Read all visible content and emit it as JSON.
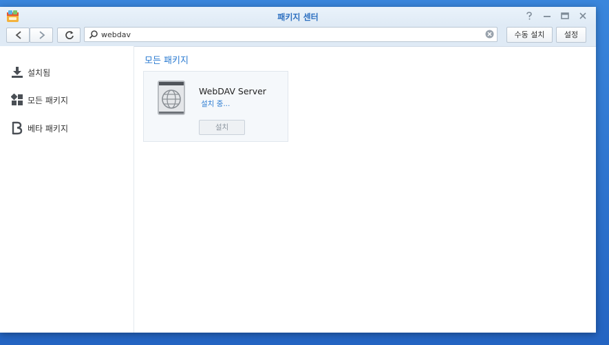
{
  "window": {
    "title": "패키지 센터",
    "controls": [
      "help-icon",
      "minimize-icon",
      "maximize-icon",
      "close-icon"
    ]
  },
  "toolbar": {
    "back_icon": "chevron-left-icon",
    "forward_icon": "chevron-right-icon",
    "refresh_icon": "refresh-icon",
    "search_value": "webdav",
    "manual_install_label": "수동 설치",
    "settings_label": "설정"
  },
  "sidebar": {
    "items": [
      {
        "label": "설치됨",
        "icon": "download-icon"
      },
      {
        "label": "모든 패키지",
        "icon": "grid-icon"
      },
      {
        "label": "베타 패키지",
        "icon": "beta-icon"
      }
    ]
  },
  "main": {
    "title": "모든 패키지",
    "packages": [
      {
        "name": "WebDAV Server",
        "status": "설치 중...",
        "button": "설치"
      }
    ]
  },
  "colors": {
    "accent": "#2b7bd1",
    "titlebar": "#dfeaf5",
    "desktop": "#2d6fc9"
  }
}
